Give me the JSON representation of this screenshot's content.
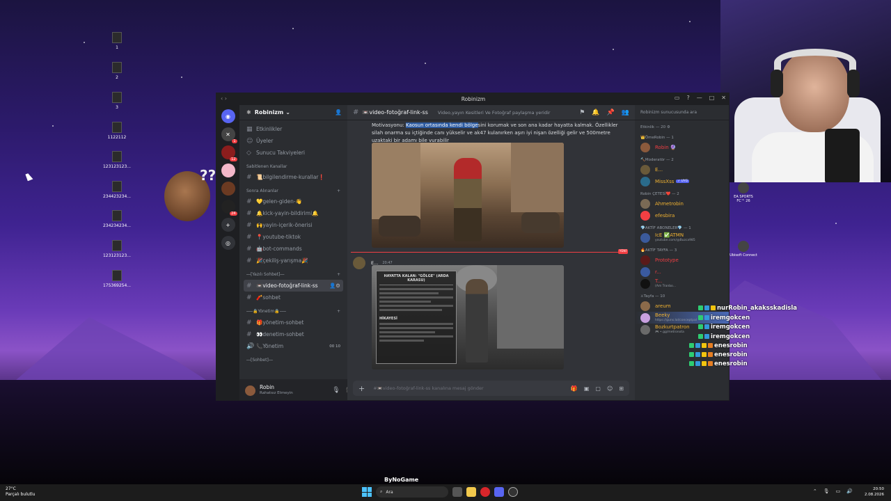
{
  "desktop": {
    "icons": [
      {
        "label": "1"
      },
      {
        "label": "2"
      },
      {
        "label": "3"
      },
      {
        "label": "1122112"
      },
      {
        "label": "123123123..."
      },
      {
        "label": "234423234..."
      },
      {
        "label": "234234234..."
      },
      {
        "label": "123123123..."
      },
      {
        "label": "175369254..."
      }
    ],
    "question_marks": "??",
    "right_icons": [
      {
        "label": "EA SPORTS FC™ 26"
      },
      {
        "label": "Ubisoft Connect"
      }
    ],
    "watermark": "ByNoGame"
  },
  "discord": {
    "window_title": "Robinizm",
    "server_name": "Robinizm",
    "sidebar_top": [
      "Etkinlikler",
      "Üyeler",
      "Sunucu Takviyeleri"
    ],
    "pinned_category": "Sabitlenen Kanallar",
    "pinned_channels": [
      "📜bilgilendirme-kurallar❗"
    ],
    "recent_category": "Sonra Alınanlar",
    "recent_channels": [
      "💛gelen-giden-👋",
      "🔔kick-yayin-bildirimi🔔",
      "🙌yayin-içerik-önerisi",
      "📍youtube-tiktok",
      "🤖bot-commands",
      "🎉çekiliş-yarışma🎉"
    ],
    "yazili_category": "⎯⎯[Yazılı Sohbet]⎯⎯",
    "yazili_channels": [
      {
        "name": "📼video-fotoğraf-link-ss",
        "active": true
      },
      {
        "name": "🧨sohbet",
        "active": false
      }
    ],
    "yonetim_category": "⎯⎯⎯🔒Yönetim🔒⎯⎯⎯",
    "yonetim_channels": [
      "🎁yönetim-sohbet",
      "👀denetim-sohbet"
    ],
    "voice_channel": {
      "name": "📞Yönetim",
      "count_left": "00",
      "count_right": "10"
    },
    "sohbet_category": "⎯⎯[Sohbet]⎯⎯",
    "user": {
      "name": "Robin",
      "status": "Rahatsız Etmeyin"
    },
    "channel": {
      "name": "📼video-fotoğraf-link-ss",
      "topic": "Video,yayın Kesitleri Ve Fotoğraf paylaşma yeridir",
      "member_search": "Robinizm sunucusunda ara"
    },
    "message1": {
      "prefix": "Motivasyonu: ",
      "highlight": "Kaosun ortasında kendi bölge",
      "rest": "sini korumak ve son ana kadar hayatta kalmak. Özellikler silah onarma su içtiğinde canı yükselir ve ak47 kulanırken aşırı iyi nişan özelliği gelir ve 500metre uzaktaki bir adamı bile vurabilir"
    },
    "new_tag": "YENİ",
    "message2": {
      "author": "E...",
      "time": "20:47",
      "card_title": "HAYATTA KALAN: \"GÖLGE\" (ARDA KARASU)",
      "card_story": "HİKAYESİ"
    },
    "composer_placeholder": "#📼video-fotoğraf-link-ss kanalına mesaj gönder",
    "member_groups": [
      {
        "title": "Etkinlik — 20 ⚙",
        "members": []
      },
      {
        "title": "👑ÖmeRobin — 1",
        "members": [
          {
            "name": "Robin 🔮",
            "color": "#f23f43",
            "sub": ""
          }
        ]
      },
      {
        "title": "🔨Moderatör — 2",
        "members": [
          {
            "name": "E...",
            "color": "#f0b232",
            "sub": ""
          },
          {
            "name": "MissXss",
            "color": "#f0b232",
            "sub": "",
            "tag": "✓ UYG"
          }
        ]
      },
      {
        "title": "Robin ÇETESİ❤️ — 2",
        "members": [
          {
            "name": "Ahmetrobin",
            "color": "#f0b232",
            "sub": ""
          },
          {
            "name": "efesbira",
            "color": "#f0b232",
            "sub": ""
          }
        ]
      },
      {
        "title": "💎AKTİF ABONELER💎 — 1",
        "members": [
          {
            "name": "IcE ✅ATMN",
            "color": "#f0b232",
            "sub": "youtube.com/@Buzca985"
          }
        ]
      },
      {
        "title": "🔥AKTİF TAYFA — 3",
        "members": [
          {
            "name": "Prototype",
            "color": "#f23f43",
            "sub": ""
          },
          {
            "name": "r...",
            "color": "#f23f43",
            "sub": ""
          },
          {
            "name": "T...",
            "color": "#f23f43",
            "sub": "(Am Tranbo..."
          }
        ]
      },
      {
        "title": "⚔Tayfa — 10",
        "members": [
          {
            "name": "areum",
            "color": "#f0b232",
            "sub": ""
          },
          {
            "name": "Beeky",
            "color": "#f0b232",
            "sub": "https://guns.lol/conceptpal"
          },
          {
            "name": "Bozkurtpatron",
            "color": "#f0b232",
            "sub": "🎮 •.gg/metronota"
          }
        ]
      }
    ]
  },
  "chat_overlay": [
    "nurRobin_akaksskadisla",
    "iremgokcen",
    "iremgokcen",
    "iremgokcen",
    "enesrobin",
    "enesrobin",
    "enesrobin"
  ],
  "taskbar": {
    "weather_temp": "27°C",
    "weather_desc": "Parçalı bulutlu",
    "search_label": "Ara",
    "time": "20:50",
    "date": "2.08.2026"
  },
  "colors": {
    "accent": "#5865f2",
    "mention_red": "#f23f43",
    "name_gold": "#f0b232"
  }
}
